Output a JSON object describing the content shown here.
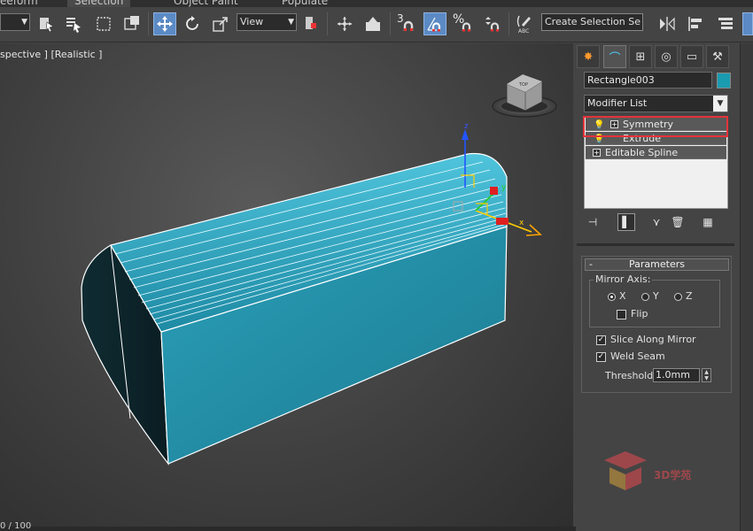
{
  "ribbon_tabs": [
    {
      "label": "eeform"
    },
    {
      "label": "Selection"
    },
    {
      "label": "Object Paint"
    },
    {
      "label": "Populate"
    }
  ],
  "toolbar": {
    "reference_coord": "View",
    "snap_value": "3",
    "named_selection": "Create Selection Se"
  },
  "viewport": {
    "label": "spective ] [Realistic ]",
    "gizmo_labels": {
      "x": "x",
      "y": "y",
      "z": "z"
    },
    "viewcube_label": "TOP"
  },
  "command_panel": {
    "object_name": "Rectangle003",
    "object_color": "#1a9bb0",
    "modifier_list": "Modifier List",
    "stack": [
      {
        "label": "Symmetry",
        "selected": true
      },
      {
        "label": "Extrude"
      },
      {
        "label": "Editable Spline"
      }
    ],
    "parameters": {
      "title": "Parameters",
      "mirror_axis_title": "Mirror Axis:",
      "axes": [
        {
          "label": "X",
          "selected": true
        },
        {
          "label": "Y",
          "selected": false
        },
        {
          "label": "Z",
          "selected": false
        }
      ],
      "flip_label": "Flip",
      "flip_checked": false,
      "slice_label": "Slice Along Mirror",
      "slice_checked": true,
      "weld_label": "Weld Seam",
      "weld_checked": true,
      "threshold_label": "Threshold:",
      "threshold_value": "1.0mm"
    }
  },
  "status": {
    "frame_counter": "0 / 100"
  },
  "watermark": {
    "text": "3D学苑"
  },
  "colors": {
    "mesh": "#2a9fb8",
    "highlight": "#e3343a",
    "active_tool": "#5b8ac4"
  }
}
